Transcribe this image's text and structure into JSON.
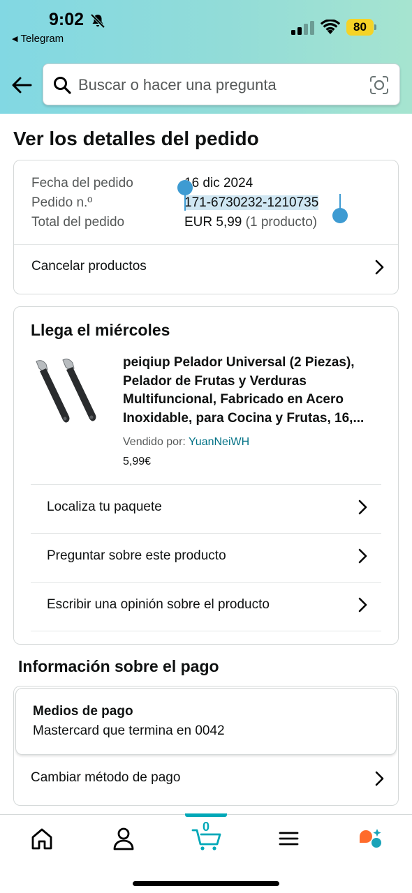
{
  "status_bar": {
    "time": "9:02",
    "back_app": "Telegram",
    "battery": "80"
  },
  "search": {
    "placeholder": "Buscar o hacer una pregunta"
  },
  "page_title": "Ver los detalles del pedido",
  "order_summary": {
    "date_label": "Fecha del pedido",
    "date_value": "16 dic 2024",
    "order_label": "Pedido n.º",
    "order_value": "171-6730232-1210735",
    "total_label": "Total del pedido",
    "total_value": "EUR 5,99",
    "total_count": "(1 producto)",
    "cancel_link": "Cancelar productos"
  },
  "shipment": {
    "title": "Llega el miércoles",
    "product_title": "peiqiup Pelador Universal (2 Piezas), Pelador de Frutas y Verduras Multifuncional, Fabricado en Acero Inoxidable, para Cocina y Frutas, 16,...",
    "sold_by_label": "Vendido por:",
    "seller": "YuanNeiWH",
    "price": "5,99€",
    "actions": [
      {
        "label": "Localiza tu paquete"
      },
      {
        "label": "Preguntar sobre este producto"
      },
      {
        "label": "Escribir una opinión sobre el producto"
      }
    ]
  },
  "payment": {
    "section_title": "Información sobre el pago",
    "methods_label": "Medios de pago",
    "card_text": "Mastercard  que termina en 0042",
    "change_link": "Cambiar método de pago"
  },
  "bottom_nav": {
    "cart_count": "0",
    "accent": "#00a8b8",
    "icons": [
      "home-icon",
      "account-icon",
      "cart-icon",
      "menu-icon",
      "rufus-icon"
    ]
  }
}
